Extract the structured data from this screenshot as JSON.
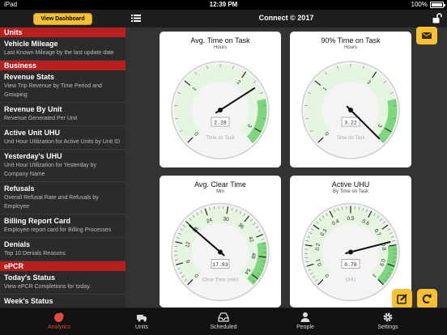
{
  "status_bar": {
    "carrier": "iPad",
    "time": "12:39 PM",
    "battery": "100%"
  },
  "sidebar": {
    "dashboard_button": "View Dashboard",
    "sections": [
      {
        "header": "Units",
        "items": [
          {
            "title": "Vehicle Mileage",
            "desc": "Last Known Mileage by the last update date"
          }
        ]
      },
      {
        "header": "Business",
        "items": [
          {
            "title": "Revenue Stats",
            "desc": "View Trip Revenue by Time Period and Grouping"
          },
          {
            "title": "Revenue By Unit",
            "desc": "Revenue Generated Per Unit"
          },
          {
            "title": "Active Unit UHU",
            "desc": "Unit Hour Utilization for Active Units by Unit ID"
          },
          {
            "title": "Yesterday's UHU",
            "desc": "Unit Hour Utilization for Yesterday by Company Name"
          },
          {
            "title": "Refusals",
            "desc": "Overall Refusal Rate and Refusals by Employee"
          },
          {
            "title": "Billing Report Card",
            "desc": "Employee report card for Billing Processes"
          },
          {
            "title": "Denials",
            "desc": "Top 10 Denials Reasons"
          }
        ]
      },
      {
        "header": "ePCR",
        "items": [
          {
            "title": "Today's Status",
            "desc": "View ePCR Completions for today."
          },
          {
            "title": "Week's Status",
            "desc": ""
          }
        ]
      }
    ]
  },
  "navbar": {
    "title": "Connect © 2017"
  },
  "gauges": [
    {
      "title": "Avg. Time on Task",
      "subtitle": "Hours",
      "readout": "2.28",
      "label": "Time on Task",
      "min": 0,
      "max": 3.2,
      "value": 2.28,
      "green_from": 2.5,
      "ticks": [
        {
          "v": 0,
          "t": "0"
        },
        {
          "v": 1,
          "t": "1"
        },
        {
          "v": 2,
          "t": "2"
        },
        {
          "v": 3,
          "t": "3"
        }
      ]
    },
    {
      "title": "90% Time on Task",
      "subtitle": "Hours",
      "readout": "3.22",
      "label": "Time on Task",
      "min": 0,
      "max": 3.2,
      "value": 3.22,
      "green_from": 2.5,
      "ticks": [
        {
          "v": 0,
          "t": "0"
        },
        {
          "v": 1,
          "t": "1"
        },
        {
          "v": 2,
          "t": "2"
        },
        {
          "v": 3,
          "t": "3"
        }
      ]
    },
    {
      "title": "Avg. Clear Time",
      "subtitle": "Min",
      "readout": "17.83",
      "label": "Clear Time (min)",
      "min": 0,
      "max": 56,
      "value": 17.83,
      "green_from": 44,
      "ticks": [
        {
          "v": 0,
          "t": "0"
        },
        {
          "v": 6,
          "t": "6"
        },
        {
          "v": 12,
          "t": "12"
        },
        {
          "v": 18,
          "t": "18"
        },
        {
          "v": 24,
          "t": "24"
        },
        {
          "v": 30,
          "t": "30"
        },
        {
          "v": 36,
          "t": "36"
        },
        {
          "v": 42,
          "t": "42"
        },
        {
          "v": 48,
          "t": "48"
        },
        {
          "v": 54,
          "t": "54"
        }
      ]
    },
    {
      "title": "Active UHU",
      "subtitle": "By Time on Task",
      "readout": "0.78",
      "label": "UHU",
      "min": 0,
      "max": 1,
      "value": 0.78,
      "green_from": 0.8,
      "ticks": [
        {
          "v": 0,
          "t": "0"
        },
        {
          "v": 0.1,
          "t": "0.1"
        },
        {
          "v": 0.2,
          "t": "0.2"
        },
        {
          "v": 0.3,
          "t": "0.3"
        },
        {
          "v": 0.4,
          "t": "0.4"
        },
        {
          "v": 0.5,
          "t": "0.5"
        },
        {
          "v": 0.6,
          "t": "0.6"
        },
        {
          "v": 0.7,
          "t": "0.7"
        },
        {
          "v": 0.8,
          "t": "0.8"
        },
        {
          "v": 0.9,
          "t": "0.9"
        },
        {
          "v": 1,
          "t": "1"
        }
      ]
    }
  ],
  "tabs": [
    {
      "label": "Analytics",
      "icon": "pie-chart-icon",
      "active": true
    },
    {
      "label": "Units",
      "icon": "truck-icon",
      "active": false
    },
    {
      "label": "Scheduled",
      "icon": "inbox-tray-icon",
      "active": false
    },
    {
      "label": "People",
      "icon": "person-icon",
      "active": false
    },
    {
      "label": "Settings",
      "icon": "gear-icon",
      "active": false
    }
  ],
  "colors": {
    "accent": "#f6c033",
    "section_header": "#b81f1f",
    "active_tab": "#e24a3b",
    "gauge_green": "#7ed67e"
  }
}
